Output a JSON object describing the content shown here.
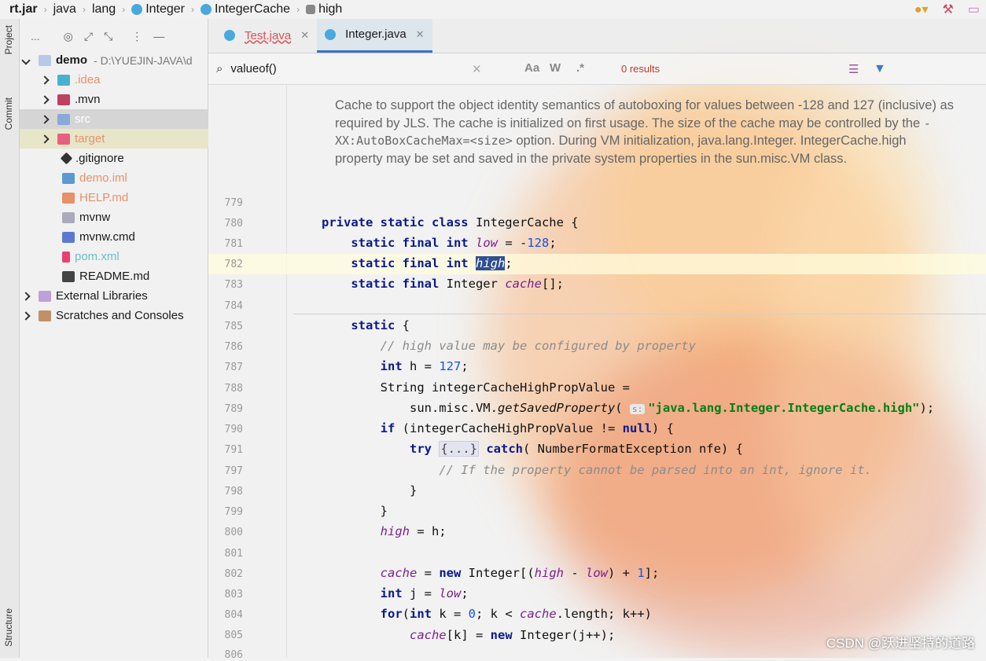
{
  "breadcrumbs": [
    "rt.jar",
    "java",
    "lang",
    "Integer",
    "IntegerCache",
    "high"
  ],
  "toolstrip": {
    "project": "Project",
    "commit": "Commit",
    "structure": "Structure"
  },
  "project_panel": {
    "toolbar_label": "...",
    "root": {
      "name": "demo",
      "path": "- D:\\YUEJIN-JAVA\\d"
    },
    "items": [
      {
        "label": ".idea",
        "color": "#e8906a"
      },
      {
        "label": ".mvn",
        "color": "#1a1a1a"
      },
      {
        "label": "src",
        "color": "#1a1a1a"
      },
      {
        "label": "target",
        "color": "#e8906a"
      },
      {
        "label": ".gitignore",
        "color": "#1a1a1a"
      },
      {
        "label": "demo.iml",
        "color": "#e8906a"
      },
      {
        "label": "HELP.md",
        "color": "#e8906a"
      },
      {
        "label": "mvnw",
        "color": "#1a1a1a"
      },
      {
        "label": "mvnw.cmd",
        "color": "#1a1a1a"
      },
      {
        "label": "pom.xml",
        "color": "#6ac0c8"
      },
      {
        "label": "README.md",
        "color": "#1a1a1a"
      }
    ],
    "ext_libs": "External Libraries",
    "scratches": "Scratches and Consoles"
  },
  "tabs": [
    {
      "label": "Test.java",
      "active": false
    },
    {
      "label": "Integer.java",
      "active": true
    }
  ],
  "search": {
    "query": "valueof()",
    "results": "0 results",
    "aa": "Aa",
    "w": "W",
    "regex": ".*"
  },
  "doc": {
    "p1": "Cache to support the object identity semantics of autoboxing for values between -128 and 127 (inclusive) as required by JLS. The cache is initialized on first usage. The size of the cache may be controlled by the",
    "code": "-XX:AutoBoxCacheMax=<size>",
    "p2": "option. During VM initialization, java.lang.Integer. IntegerCache.high property may be set and saved in the private system properties in the sun.misc.VM class."
  },
  "lines": [
    "779",
    "780",
    "781",
    "782",
    "783",
    "784",
    "785",
    "786",
    "787",
    "788",
    "789",
    "790",
    "791",
    "797",
    "798",
    "799",
    "800",
    "801",
    "802",
    "803",
    "804",
    "805",
    "806"
  ],
  "hint": "s:",
  "watermark": "CSDN @跃进坚持的道路"
}
